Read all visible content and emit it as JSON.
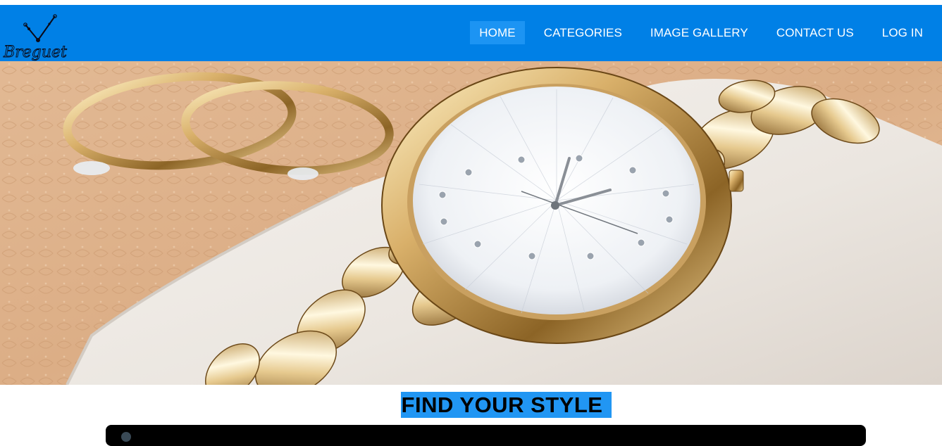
{
  "brand": {
    "name": "Breguet",
    "logo_icon": "watch-hands-logo-icon"
  },
  "nav": {
    "items": [
      {
        "label": "HOME",
        "active": true
      },
      {
        "label": "CATEGORIES",
        "active": false
      },
      {
        "label": "IMAGE GALLERY",
        "active": false
      },
      {
        "label": "CONTACT US",
        "active": false
      },
      {
        "label": "LOG IN",
        "active": false
      }
    ]
  },
  "hero": {
    "subject": "gold chain-link wristwatch on white cushion beside gold rings"
  },
  "section": {
    "heading": "FIND YOUR STYLE"
  },
  "colors": {
    "navbar": "#0080e6",
    "nav_active": "#1c94f3",
    "heading_highlight": "#2196f3",
    "video_bg": "#000000"
  }
}
